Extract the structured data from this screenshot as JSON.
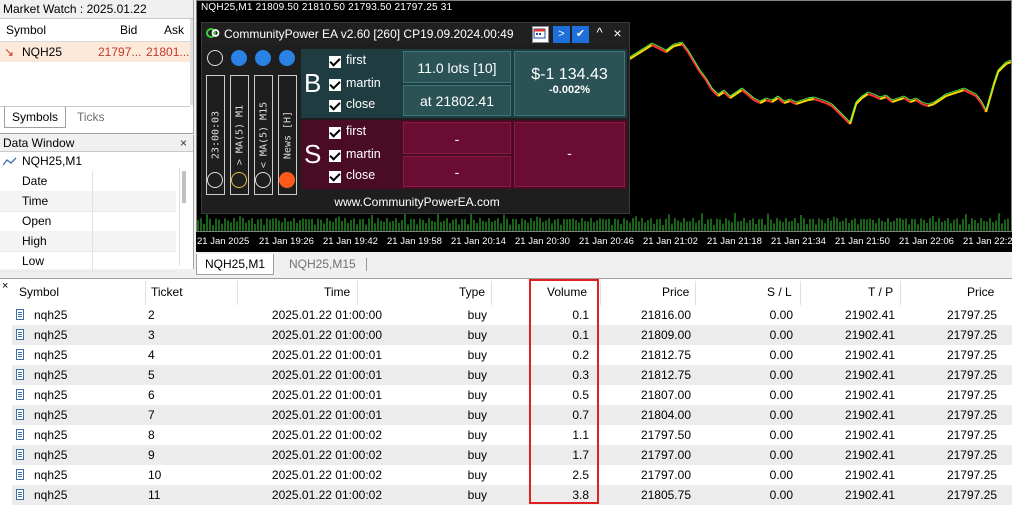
{
  "market_watch": {
    "title": "Market Watch : 2025.01.22",
    "columns": [
      "Symbol",
      "Bid",
      "Ask"
    ],
    "row": {
      "arrow": "↘",
      "symbol": "NQH25",
      "bid": "21797...",
      "ask": "21801..."
    },
    "tabs": [
      "Symbols",
      "Ticks"
    ]
  },
  "data_window": {
    "title": "Data Window",
    "close": "×",
    "symbol": "NQH25,M1",
    "rows": [
      "Date",
      "Time",
      "Open",
      "High",
      "Low"
    ]
  },
  "chart": {
    "title": "NQH25,M1  21809.50 21810.50 21793.50 21797.25  31",
    "time_labels": [
      "21 Jan 2025",
      "21 Jan 19:26",
      "21 Jan 19:42",
      "21 Jan 19:58",
      "21 Jan 20:14",
      "21 Jan 20:30",
      "21 Jan 20:46",
      "21 Jan 21:02",
      "21 Jan 21:18",
      "21 Jan 21:34",
      "21 Jan 21:50",
      "21 Jan 22:06",
      "21 Jan 22:2"
    ],
    "colors": {
      "bull": "#ffd800",
      "bear": "#ff3030",
      "ma": "#4cff4c",
      "volume": "#32c832",
      "background": "#000000"
    }
  },
  "ea_panel": {
    "title": "CommunityPower EA v2.60 [260]  CP19.09.2024.00:49",
    "header_buttons": [
      "chart-icon",
      ">",
      "✔",
      "^",
      "×"
    ],
    "indicators": [
      "23:00:03",
      "> MA(5) M1",
      "< MA(5) M15",
      "News [H]"
    ],
    "buy": {
      "letter": "B",
      "checks": [
        "first",
        "martin",
        "close"
      ],
      "lots": "11.0 lots [10]",
      "price": "at 21802.41",
      "pnl": "$-1 134.43",
      "pnl_pct": "-0.002%"
    },
    "sell": {
      "letter": "S",
      "checks": [
        "first",
        "martin",
        "close"
      ],
      "lots": "-",
      "price": "-",
      "pnl": "-"
    },
    "site": "www.CommunityPowerEA.com",
    "colors": {
      "buy_bg": "#1f3d40",
      "sell_bg": "#5a0a2a",
      "border_buy": "#2e6a6e",
      "border_sell": "#8a1a44"
    }
  },
  "chart_tabs": [
    "NQH25,M1",
    "NQH25,M15"
  ],
  "table": {
    "close": "×",
    "headers": [
      "Symbol",
      "Ticket",
      "Time",
      "Type",
      "Volume",
      "Price",
      "S / L",
      "T / P",
      "Price"
    ],
    "rows": [
      {
        "symbol": "nqh25",
        "ticket": "2",
        "time": "2025.01.22 01:00:00",
        "type": "buy",
        "volume": "0.1",
        "price": "21816.00",
        "sl": "0.00",
        "tp": "21902.41",
        "cur": "21797.25"
      },
      {
        "symbol": "nqh25",
        "ticket": "3",
        "time": "2025.01.22 01:00:00",
        "type": "buy",
        "volume": "0.1",
        "price": "21809.00",
        "sl": "0.00",
        "tp": "21902.41",
        "cur": "21797.25"
      },
      {
        "symbol": "nqh25",
        "ticket": "4",
        "time": "2025.01.22 01:00:01",
        "type": "buy",
        "volume": "0.2",
        "price": "21812.75",
        "sl": "0.00",
        "tp": "21902.41",
        "cur": "21797.25"
      },
      {
        "symbol": "nqh25",
        "ticket": "5",
        "time": "2025.01.22 01:00:01",
        "type": "buy",
        "volume": "0.3",
        "price": "21812.75",
        "sl": "0.00",
        "tp": "21902.41",
        "cur": "21797.25"
      },
      {
        "symbol": "nqh25",
        "ticket": "6",
        "time": "2025.01.22 01:00:01",
        "type": "buy",
        "volume": "0.5",
        "price": "21807.00",
        "sl": "0.00",
        "tp": "21902.41",
        "cur": "21797.25"
      },
      {
        "symbol": "nqh25",
        "ticket": "7",
        "time": "2025.01.22 01:00:01",
        "type": "buy",
        "volume": "0.7",
        "price": "21804.00",
        "sl": "0.00",
        "tp": "21902.41",
        "cur": "21797.25"
      },
      {
        "symbol": "nqh25",
        "ticket": "8",
        "time": "2025.01.22 01:00:02",
        "type": "buy",
        "volume": "1.1",
        "price": "21797.50",
        "sl": "0.00",
        "tp": "21902.41",
        "cur": "21797.25"
      },
      {
        "symbol": "nqh25",
        "ticket": "9",
        "time": "2025.01.22 01:00:02",
        "type": "buy",
        "volume": "1.7",
        "price": "21797.00",
        "sl": "0.00",
        "tp": "21902.41",
        "cur": "21797.25"
      },
      {
        "symbol": "nqh25",
        "ticket": "10",
        "time": "2025.01.22 01:00:02",
        "type": "buy",
        "volume": "2.5",
        "price": "21797.00",
        "sl": "0.00",
        "tp": "21902.41",
        "cur": "21797.25"
      },
      {
        "symbol": "nqh25",
        "ticket": "11",
        "time": "2025.01.22 01:00:02",
        "type": "buy",
        "volume": "3.8",
        "price": "21805.75",
        "sl": "0.00",
        "tp": "21902.41",
        "cur": "21797.25"
      }
    ],
    "highlight_color": "#e02020"
  }
}
